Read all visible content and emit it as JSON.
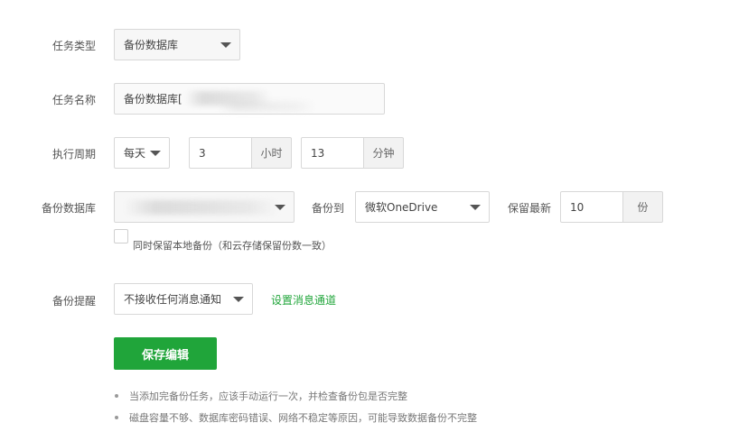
{
  "form": {
    "task_type": {
      "label": "任务类型",
      "value": "备份数据库"
    },
    "task_name": {
      "label": "任务名称",
      "value": "备份数据库["
    },
    "period": {
      "label": "执行周期",
      "cycle": "每天",
      "hours": "3",
      "hours_unit": "小时",
      "minutes": "13",
      "minutes_unit": "分钟"
    },
    "backup_db": {
      "label": "备份数据库",
      "target_label": "备份到",
      "target_value": "微软OneDrive",
      "keep_label": "保留最新",
      "keep_value": "10",
      "keep_unit": "份",
      "local_checkbox_label": "同时保留本地备份（和云存储保留份数一致）"
    },
    "reminder": {
      "label": "备份提醒",
      "value": "不接收任何消息通知",
      "link": "设置消息通道"
    },
    "save_button": "保存编辑"
  },
  "tips": [
    "当添加完备份任务，应该手动运行一次，并检查备份包是否完整",
    "磁盘容量不够、数据库密码错误、网络不稳定等原因，可能导致数据备份不完整"
  ],
  "colors": {
    "accent": "#20a53a",
    "label": "#555555",
    "border": "#d8d8d8"
  }
}
